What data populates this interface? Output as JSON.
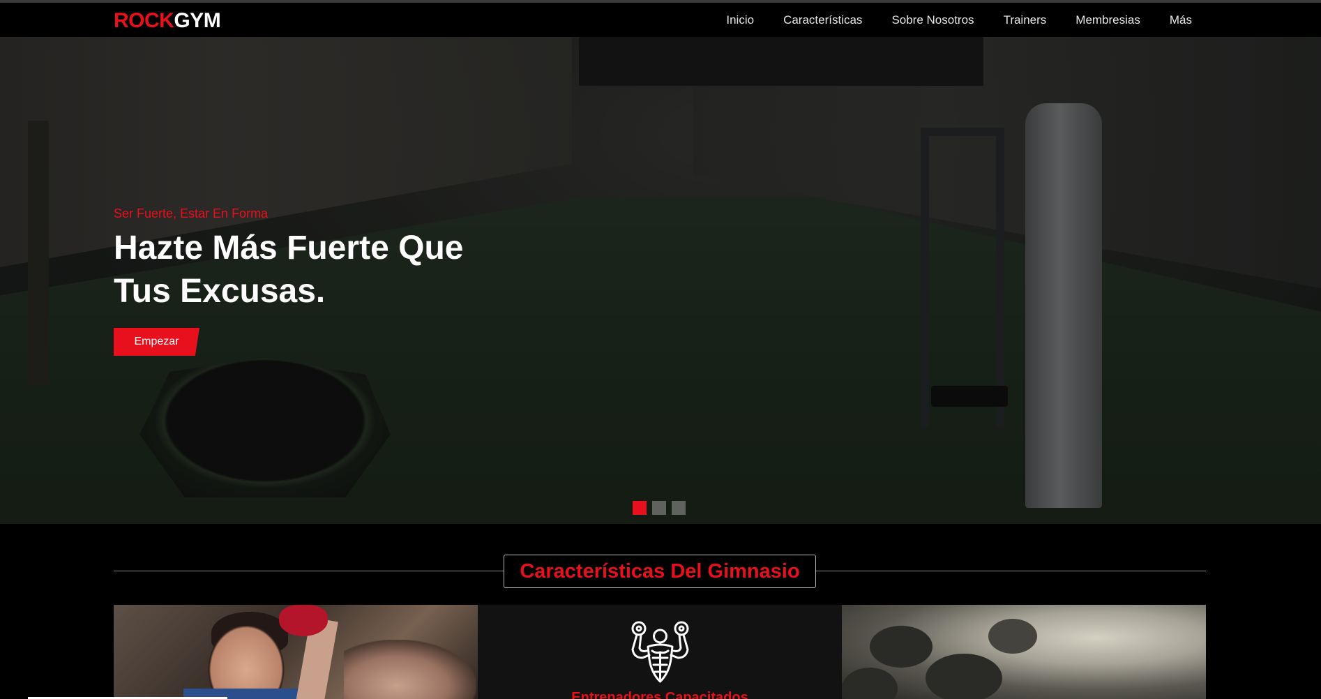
{
  "brand": {
    "part1": "ROCK",
    "part2": "GYM"
  },
  "nav": {
    "items": [
      {
        "label": "Inicio"
      },
      {
        "label": "Características"
      },
      {
        "label": "Sobre Nosotros"
      },
      {
        "label": "Trainers"
      },
      {
        "label": "Membresias"
      },
      {
        "label": "Más"
      }
    ]
  },
  "hero": {
    "kicker": "Ser Fuerte, Estar En Forma",
    "title_line1": "Hazte Más Fuerte Que",
    "title_line2": "Tus Excusas.",
    "cta_label": "Empezar",
    "slides_total": 3,
    "active_slide": 1
  },
  "features": {
    "section_title": "Características Del Gimnasio",
    "cards": [
      {
        "type": "image",
        "image": "trainer-with-client-photo"
      },
      {
        "type": "icon",
        "icon": "muscle-dumbbells-icon",
        "title": "Entrenadores Capacitados"
      },
      {
        "type": "image",
        "image": "dumbbells-blur-photo"
      }
    ]
  },
  "colors": {
    "accent": "#e8101c",
    "background": "#000000",
    "nav_text": "#e6e6e6",
    "card_dark": "#121212",
    "dot_inactive": "#5f625e"
  }
}
